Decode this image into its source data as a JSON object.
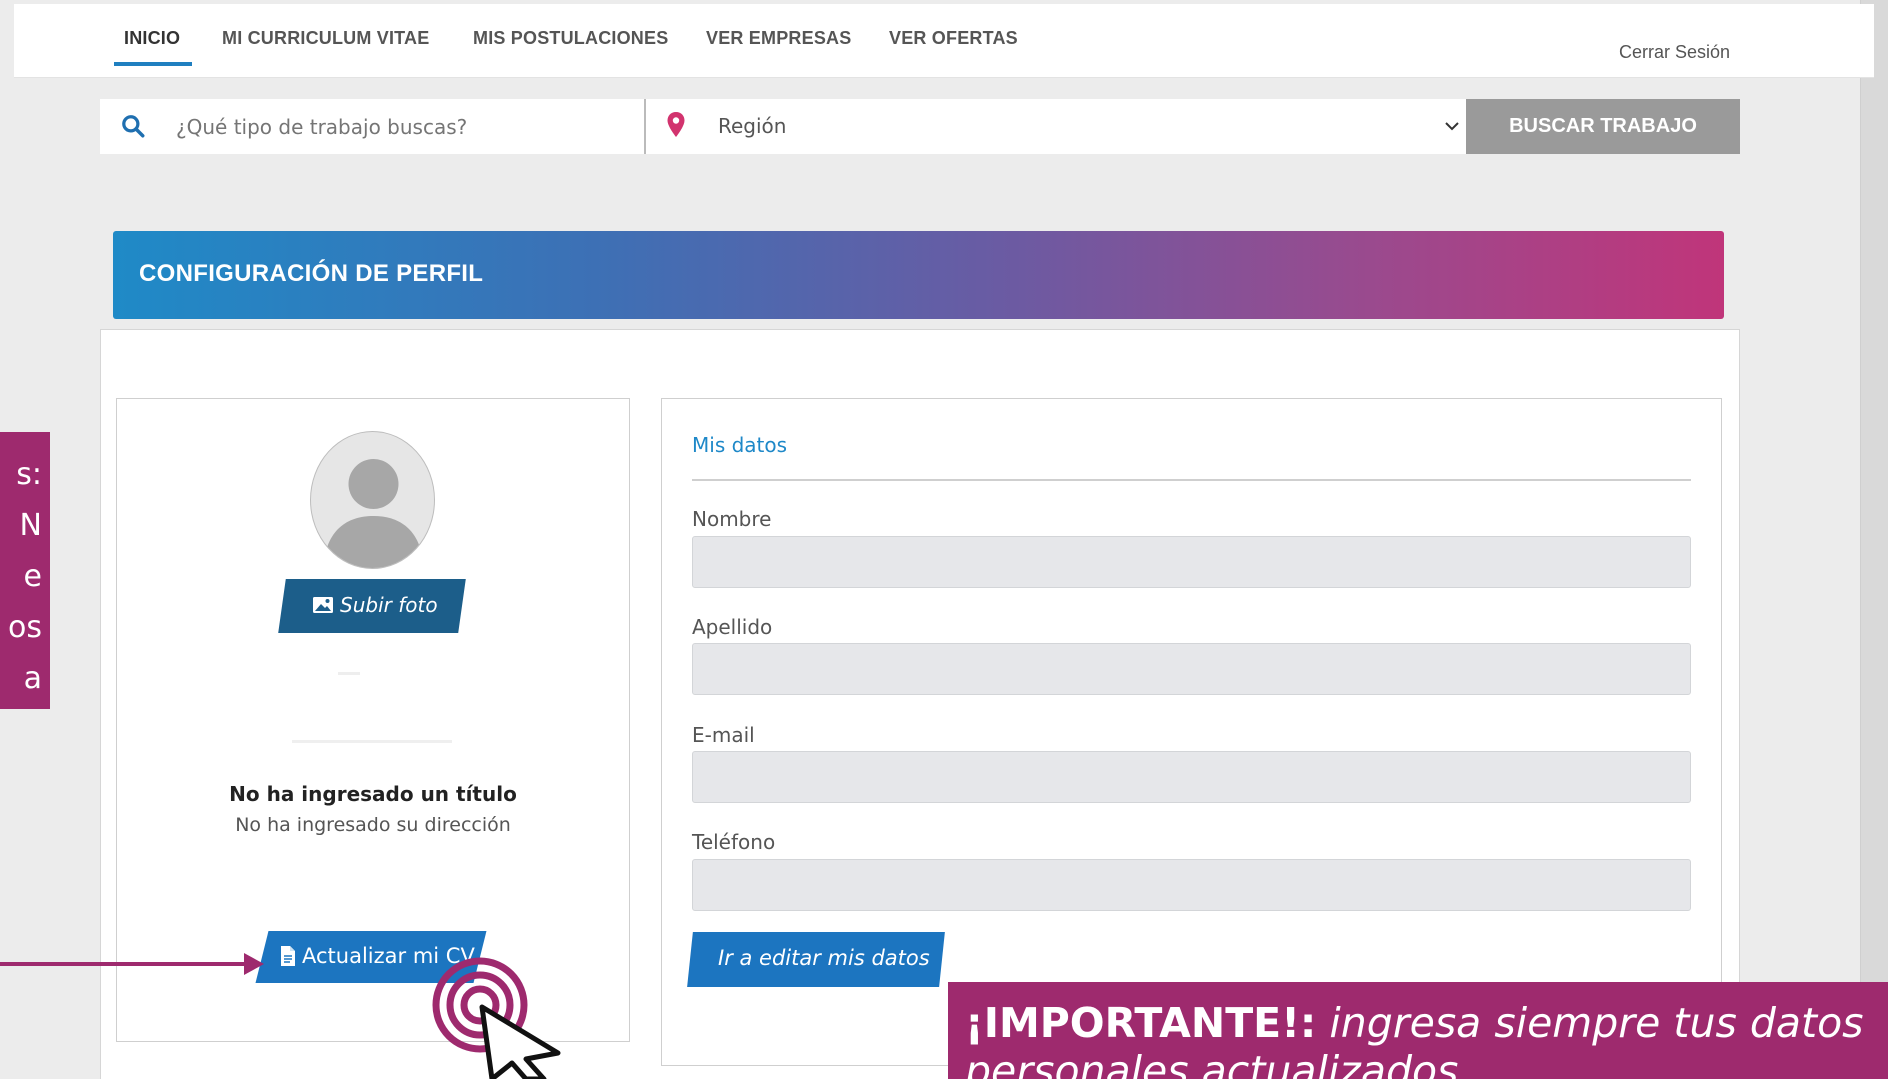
{
  "nav": {
    "tabs": [
      {
        "label": "INICIO"
      },
      {
        "label": "MI CURRICULUM VITAE"
      },
      {
        "label": "MIS POSTULACIONES"
      },
      {
        "label": "VER EMPRESAS"
      },
      {
        "label": "VER OFERTAS"
      }
    ],
    "logout": "Cerrar Sesión"
  },
  "search": {
    "placeholder": "¿Qué tipo de trabajo buscas?",
    "region": "Región",
    "button": "BUSCAR TRABAJO"
  },
  "header": {
    "title": "CONFIGURACIÓN DE PERFIL"
  },
  "profile": {
    "upload_photo": "Subir foto",
    "title_text": "No ha ingresado un título",
    "address_text": "No ha ingresado su dirección",
    "update_cv": "Actualizar mi CV"
  },
  "data": {
    "section_title": "Mis datos",
    "fields": [
      {
        "label": "Nombre",
        "value": ""
      },
      {
        "label": "Apellido",
        "value": ""
      },
      {
        "label": "E-mail",
        "value": ""
      },
      {
        "label": "Teléfono",
        "value": ""
      }
    ],
    "edit_button": "Ir a editar mis datos"
  },
  "overlay": {
    "side_note_lines": [
      "s:",
      "N",
      "e",
      "os",
      "a"
    ],
    "important_label": "¡IMPORTANTE!:",
    "important_text": " ingresa siempre tus datos",
    "important_text2": "personales actualizados"
  },
  "colors": {
    "accent": "#1f7fc0",
    "brand_magenta": "#9e2a6e",
    "banner_start": "#1f8ac7",
    "banner_end": "#c0357a",
    "search_button": "#9a9a9a"
  },
  "icons": [
    "search-icon",
    "map-pin-icon",
    "chevron-down-icon",
    "image-icon",
    "document-icon",
    "cursor-click-icon"
  ]
}
